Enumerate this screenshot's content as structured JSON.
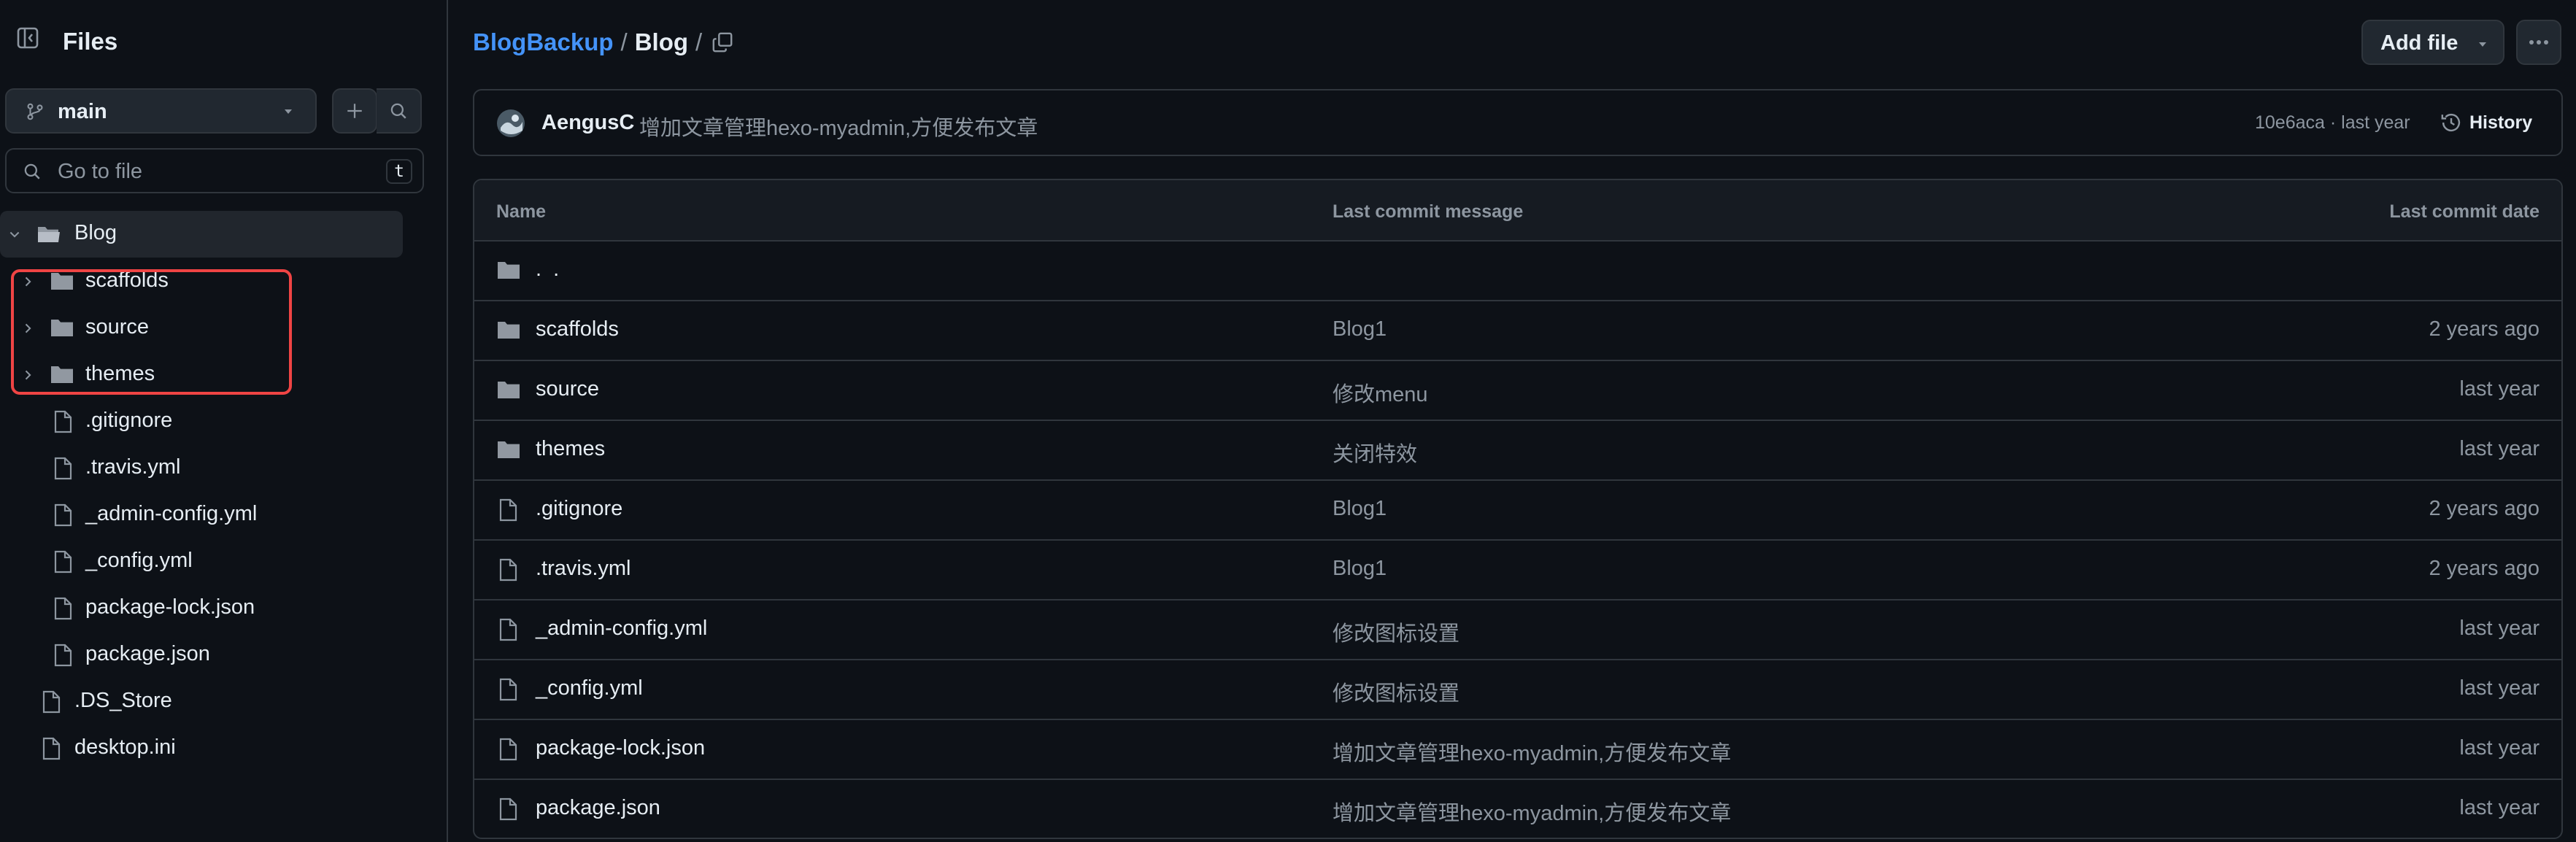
{
  "sidebar": {
    "title": "Files",
    "branch": "main",
    "search_placeholder": "Go to file",
    "search_shortcut": "t",
    "root_folder": "Blog",
    "tree": [
      {
        "label": "scaffolds",
        "type": "folder",
        "expandable": true
      },
      {
        "label": "source",
        "type": "folder",
        "expandable": true
      },
      {
        "label": "themes",
        "type": "folder",
        "expandable": true
      },
      {
        "label": ".gitignore",
        "type": "file"
      },
      {
        "label": ".travis.yml",
        "type": "file"
      },
      {
        "label": "_admin-config.yml",
        "type": "file"
      },
      {
        "label": "_config.yml",
        "type": "file"
      },
      {
        "label": "package-lock.json",
        "type": "file"
      },
      {
        "label": "package.json",
        "type": "file"
      }
    ],
    "root_files": [
      {
        "label": ".DS_Store",
        "type": "file"
      },
      {
        "label": "desktop.ini",
        "type": "file"
      }
    ]
  },
  "breadcrumb": {
    "repo": "BlogBackup",
    "sep1": "/",
    "folder": "Blog",
    "sep2": "/"
  },
  "header": {
    "add_file_label": "Add file"
  },
  "commit": {
    "author": "AengusC",
    "message": "增加文章管理hexo-myadmin,方便发布文章",
    "meta": "10e6aca · last year",
    "history_label": "History"
  },
  "table": {
    "headers": {
      "name": "Name",
      "message": "Last commit message",
      "date": "Last commit date"
    },
    "parent_label": ". .",
    "rows": [
      {
        "name": "scaffolds",
        "type": "folder",
        "message": "Blog1",
        "date": "2 years ago"
      },
      {
        "name": "source",
        "type": "folder",
        "message": "修改menu",
        "date": "last year"
      },
      {
        "name": "themes",
        "type": "folder",
        "message": "关闭特效",
        "date": "last year"
      },
      {
        "name": ".gitignore",
        "type": "file",
        "message": "Blog1",
        "date": "2 years ago"
      },
      {
        "name": ".travis.yml",
        "type": "file",
        "message": "Blog1",
        "date": "2 years ago"
      },
      {
        "name": "_admin-config.yml",
        "type": "file",
        "message": "修改图标设置",
        "date": "last year"
      },
      {
        "name": "_config.yml",
        "type": "file",
        "message": "修改图标设置",
        "date": "last year"
      },
      {
        "name": "package-lock.json",
        "type": "file",
        "message": "增加文章管理hexo-myadmin,方便发布文章",
        "date": "last year"
      },
      {
        "name": "package.json",
        "type": "file",
        "message": "增加文章管理hexo-myadmin,方便发布文章",
        "date": "last year"
      }
    ]
  },
  "colors": {
    "background": "#0d1117",
    "link": "#4493f8",
    "highlight_box": "#ef4444"
  }
}
